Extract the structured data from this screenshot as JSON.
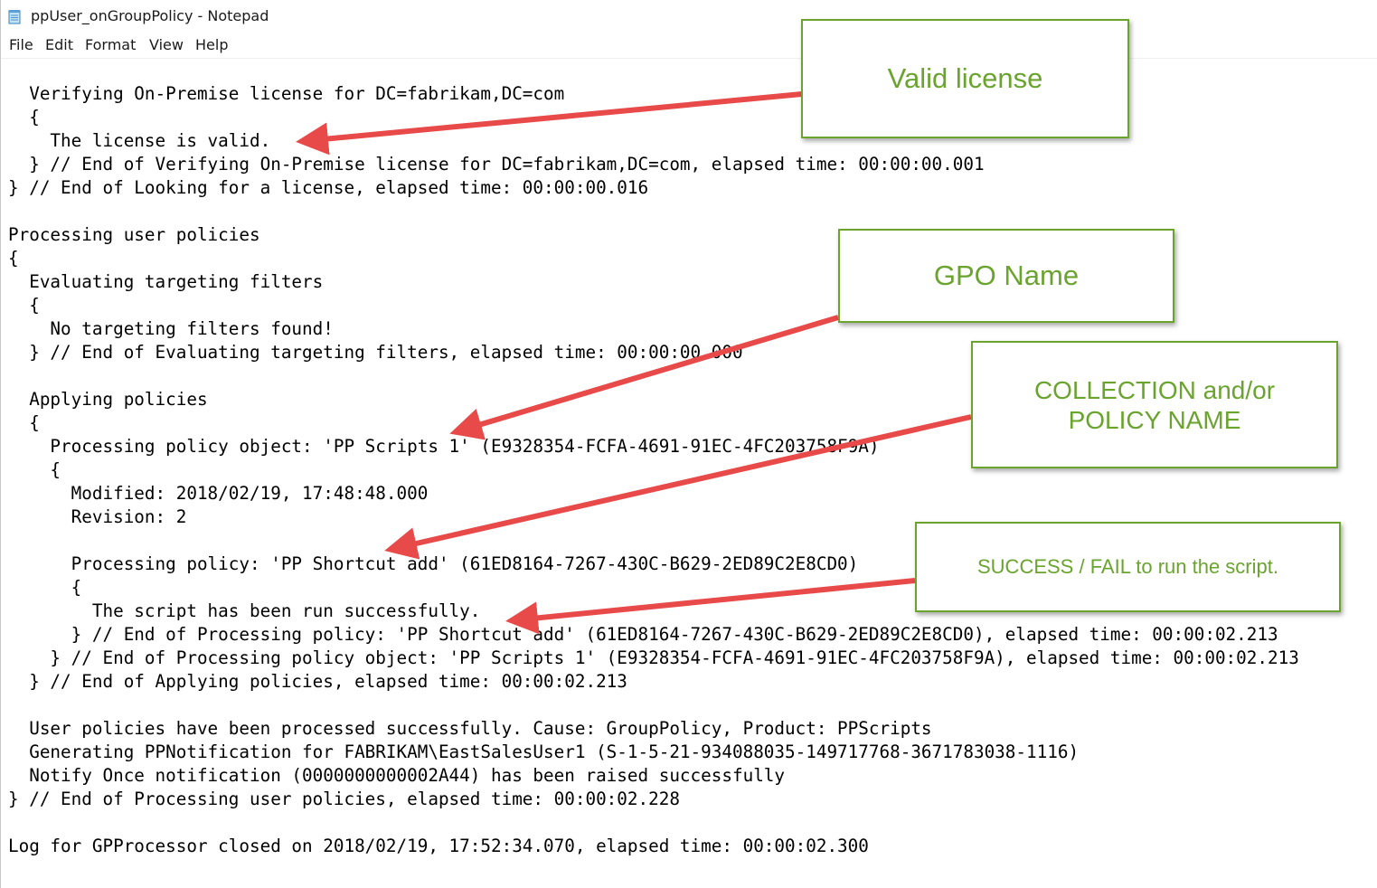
{
  "window": {
    "title": "ppUser_onGroupPolicy - Notepad",
    "app_icon": "notepad-icon"
  },
  "menu": {
    "file": "File",
    "edit": "Edit",
    "format": "Format",
    "view": "View",
    "help": "Help"
  },
  "log_lines": [
    "  Verifying On-Premise license for DC=fabrikam,DC=com",
    "  {",
    "    The license is valid.",
    "  } // End of Verifying On-Premise license for DC=fabrikam,DC=com, elapsed time: 00:00:00.001",
    "} // End of Looking for a license, elapsed time: 00:00:00.016",
    "",
    "Processing user policies",
    "{",
    "  Evaluating targeting filters",
    "  {",
    "    No targeting filters found!",
    "  } // End of Evaluating targeting filters, elapsed time: 00:00:00.000",
    "",
    "  Applying policies",
    "  {",
    "    Processing policy object: 'PP Scripts 1' (E9328354-FCFA-4691-91EC-4FC203758F9A)",
    "    {",
    "      Modified: 2018/02/19, 17:48:48.000",
    "      Revision: 2",
    "",
    "      Processing policy: 'PP Shortcut add' (61ED8164-7267-430C-B629-2ED89C2E8CD0)",
    "      {",
    "        The script has been run successfully.",
    "      } // End of Processing policy: 'PP Shortcut add' (61ED8164-7267-430C-B629-2ED89C2E8CD0), elapsed time: 00:00:02.213",
    "    } // End of Processing policy object: 'PP Scripts 1' (E9328354-FCFA-4691-91EC-4FC203758F9A), elapsed time: 00:00:02.213",
    "  } // End of Applying policies, elapsed time: 00:00:02.213",
    "",
    "  User policies have been processed successfully. Cause: GroupPolicy, Product: PPScripts",
    "  Generating PPNotification for FABRIKAM\\EastSalesUser1 (S-1-5-21-934088035-149717768-3671783038-1116)",
    "  Notify Once notification (0000000000002A44) has been raised successfully",
    "} // End of Processing user policies, elapsed time: 00:00:02.228",
    "",
    "Log for GPProcessor closed on 2018/02/19, 17:52:34.070, elapsed time: 00:00:02.300"
  ],
  "callouts": {
    "valid_license": "Valid license",
    "gpo_name": "GPO Name",
    "collection_policy_line1": "COLLECTION and/or",
    "collection_policy_line2": "POLICY NAME",
    "success_fail": "SUCCESS / FAIL to run the script."
  },
  "colors": {
    "callout_green": "#6aa42f",
    "arrow_red": "#e84a4a",
    "text": "#000000"
  }
}
